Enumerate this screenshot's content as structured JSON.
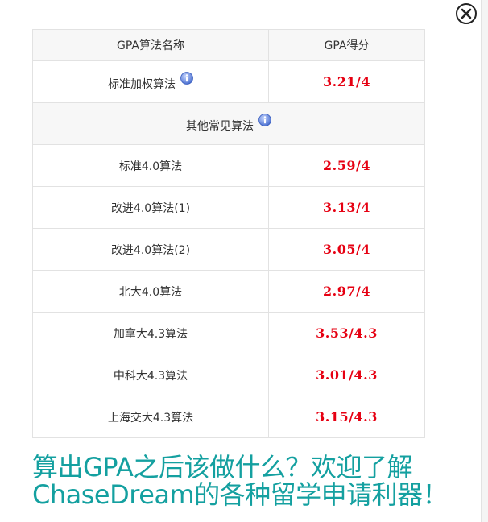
{
  "dialog": {
    "close_label": "close"
  },
  "table": {
    "headers": {
      "method": "GPA算法名称",
      "score": "GPA得分"
    },
    "primary_row": {
      "method": "标准加权算法",
      "score": "3.21/4"
    },
    "section_label": "其他常见算法",
    "rows": [
      {
        "method": "标准4.0算法",
        "score": "2.59/4"
      },
      {
        "method": "改进4.0算法(1)",
        "score": "3.13/4"
      },
      {
        "method": "改进4.0算法(2)",
        "score": "3.05/4"
      },
      {
        "method": "北大4.0算法",
        "score": "2.97/4"
      },
      {
        "method": "加拿大4.3算法",
        "score": "3.53/4.3"
      },
      {
        "method": "中科大4.3算法",
        "score": "3.01/4.3"
      },
      {
        "method": "上海交大4.3算法",
        "score": "3.15/4.3"
      }
    ]
  },
  "promo": {
    "line1": "算出GPA之后该做什么？欢迎了解",
    "line2": "ChaseDream的各种留学申请利器！"
  },
  "colors": {
    "score_red": "#e60012",
    "promo_teal": "#14a0a0",
    "info_blue": "#5b7fd6"
  },
  "icons": {
    "close": "close-icon",
    "info": "info-icon"
  }
}
